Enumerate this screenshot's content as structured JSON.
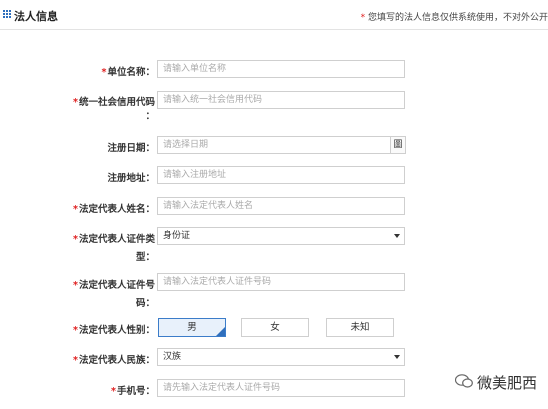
{
  "header": {
    "title": "法人信息",
    "note_star": "*",
    "note": "您填写的法人信息仅供系统使用，不对外公开"
  },
  "form": {
    "req_mark": "*",
    "unit_name": {
      "label": "单位名称：",
      "placeholder": "请输入单位名称"
    },
    "credit_code": {
      "label_line1": "统一社会信用代码",
      "label_line2": "：",
      "placeholder": "请输入统一社会信用代码"
    },
    "reg_date": {
      "label": "注册日期：",
      "placeholder": "请选择日期",
      "button": "圖"
    },
    "reg_address": {
      "label": "注册地址：",
      "placeholder": "请输入注册地址"
    },
    "legal_name": {
      "label": "法定代表人姓名：",
      "placeholder": "请输入法定代表人姓名"
    },
    "id_type": {
      "label_line1": "法定代表人证件类",
      "label_line2": "型：",
      "value": "身份证"
    },
    "id_number": {
      "label_line1": "法定代表人证件号",
      "label_line2": "码：",
      "placeholder": "请输入法定代表人证件号码"
    },
    "gender": {
      "label": "法定代表人性别：",
      "options": [
        "男",
        "女",
        "未知"
      ],
      "selected": "男"
    },
    "ethnicity": {
      "label": "法定代表人民族：",
      "value": "汉族"
    },
    "phone": {
      "label": "手机号：",
      "placeholder": "请先输入法定代表人证件号码"
    }
  },
  "watermark": {
    "text": "微美肥西"
  }
}
